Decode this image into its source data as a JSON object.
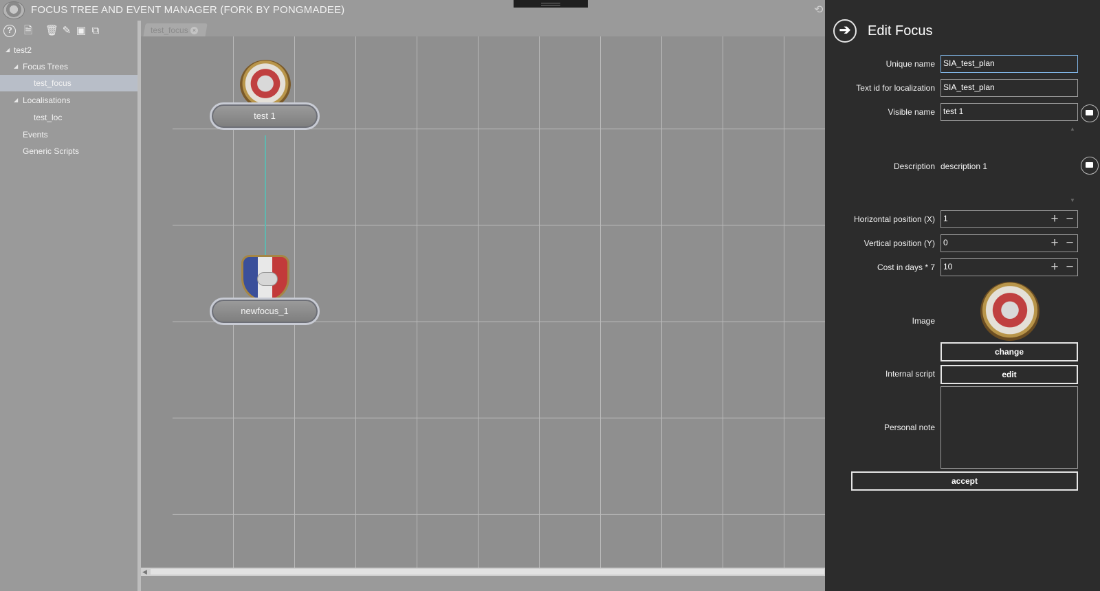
{
  "app": {
    "title": "FOCUS TREE AND EVENT MANAGER (FORK BY PONGMADEE)"
  },
  "toolbar": {
    "icons": [
      "help-icon",
      "new-file-icon",
      "delete-icon",
      "edit-icon",
      "image-icon",
      "copy-icon"
    ]
  },
  "tree": {
    "root": "test2",
    "focus_trees": "Focus Trees",
    "test_focus": "test_focus",
    "localisations": "Localisations",
    "test_loc": "test_loc",
    "events": "Events",
    "generic_scripts": "Generic Scripts"
  },
  "document": {
    "tab_label": "test_focus",
    "nodes": [
      {
        "label": "test 1",
        "image": "china-map-emblem"
      },
      {
        "label": "newfocus_1",
        "image": "france-handshake-emblem"
      }
    ]
  },
  "panel": {
    "title": "Edit Focus",
    "unique_name_label": "Unique name",
    "unique_name_value": "SIA_test_plan",
    "text_id_label": "Text id for localization",
    "text_id_value": "SIA_test_plan",
    "visible_name_label": "Visible name",
    "visible_name_value": "test 1",
    "description_label": "Description",
    "description_value": "description 1",
    "hpos_label": "Horizontal position (X)",
    "hpos_value": "1",
    "vpos_label": "Vertical position (Y)",
    "vpos_value": "0",
    "cost_label": "Cost in days * 7",
    "cost_value": "10",
    "image_label": "Image",
    "change_button": "change",
    "script_label": "Internal script",
    "edit_button": "edit",
    "note_label": "Personal note",
    "note_value": "",
    "accept_button": "accept"
  },
  "colors": {
    "panel_bg": "#2c2c2c",
    "sidebar_bg": "#9a9a9a",
    "canvas_bg": "#8f8f8f",
    "selection": "#b8bec8",
    "connector": "#5fb8b0",
    "focus_border": "#7fb3e3"
  }
}
